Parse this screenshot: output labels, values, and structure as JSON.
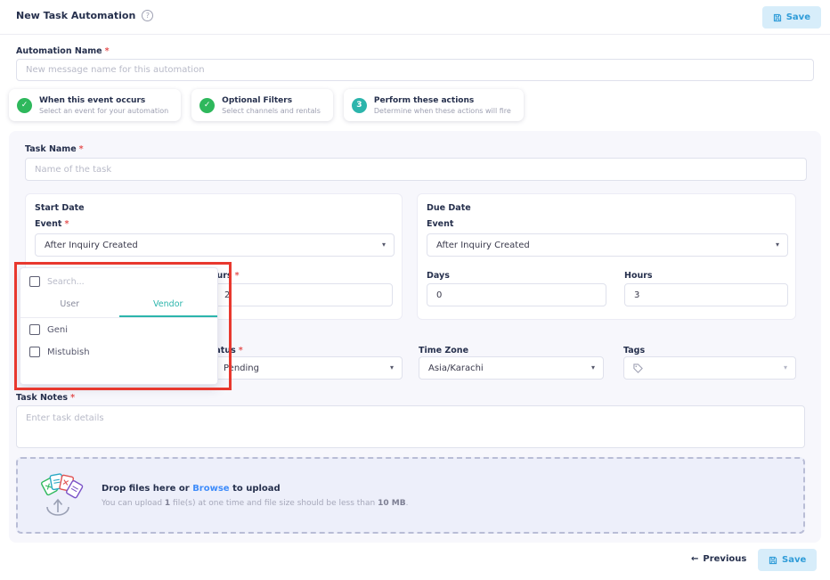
{
  "icons": {
    "chevron_down": "▾",
    "arrow_left": "←",
    "info": "?"
  },
  "required_mark": "*",
  "header": {
    "title": "New Task Automation",
    "save_label": "Save"
  },
  "automation_name": {
    "label": "Automation Name",
    "placeholder": "New message name for this automation"
  },
  "stepper": {
    "steps": [
      {
        "badge": "✓",
        "title": "When this event occurs",
        "subtitle": "Select an event for your automation"
      },
      {
        "badge": "✓",
        "title": "Optional Filters",
        "subtitle": "Select channels and rentals"
      },
      {
        "badge": "3",
        "title": "Perform these actions",
        "subtitle": "Determine when these actions will fire"
      }
    ]
  },
  "form": {
    "task_name": {
      "label": "Task Name",
      "placeholder": "Name of the task"
    },
    "start_date": {
      "title": "Start Date",
      "event_label": "Event",
      "event_value": "After Inquiry Created",
      "hours_label": "Hours",
      "hours_value": "2"
    },
    "due_date": {
      "title": "Due Date",
      "event_label": "Event",
      "event_value": "After Inquiry Created",
      "days_label": "Days",
      "days_value": "0",
      "hours_label": "Hours",
      "hours_value": "3"
    },
    "status": {
      "label": "Status",
      "value": "Pending"
    },
    "time_zone": {
      "label": "Time Zone",
      "value": "Asia/Karachi"
    },
    "tags": {
      "label": "Tags"
    },
    "task_notes": {
      "label": "Task Notes",
      "placeholder": "Enter task details"
    }
  },
  "assignee_dropdown": {
    "search_placeholder": "Search...",
    "tabs": [
      {
        "label": "User"
      },
      {
        "label": "Vendor"
      }
    ],
    "active_tab": "Vendor",
    "options": [
      "Geni",
      "Mistubish"
    ]
  },
  "upload": {
    "title_prefix": "Drop files here or ",
    "browse_label": "Browse",
    "title_suffix": " to upload",
    "hint_prefix": "You can upload ",
    "hint_count": "1",
    "hint_middle": " file(s) at one time and file size should be less than ",
    "hint_size": "10 MB",
    "hint_end": "."
  },
  "footer": {
    "previous_label": "Previous",
    "save_label": "Save"
  }
}
